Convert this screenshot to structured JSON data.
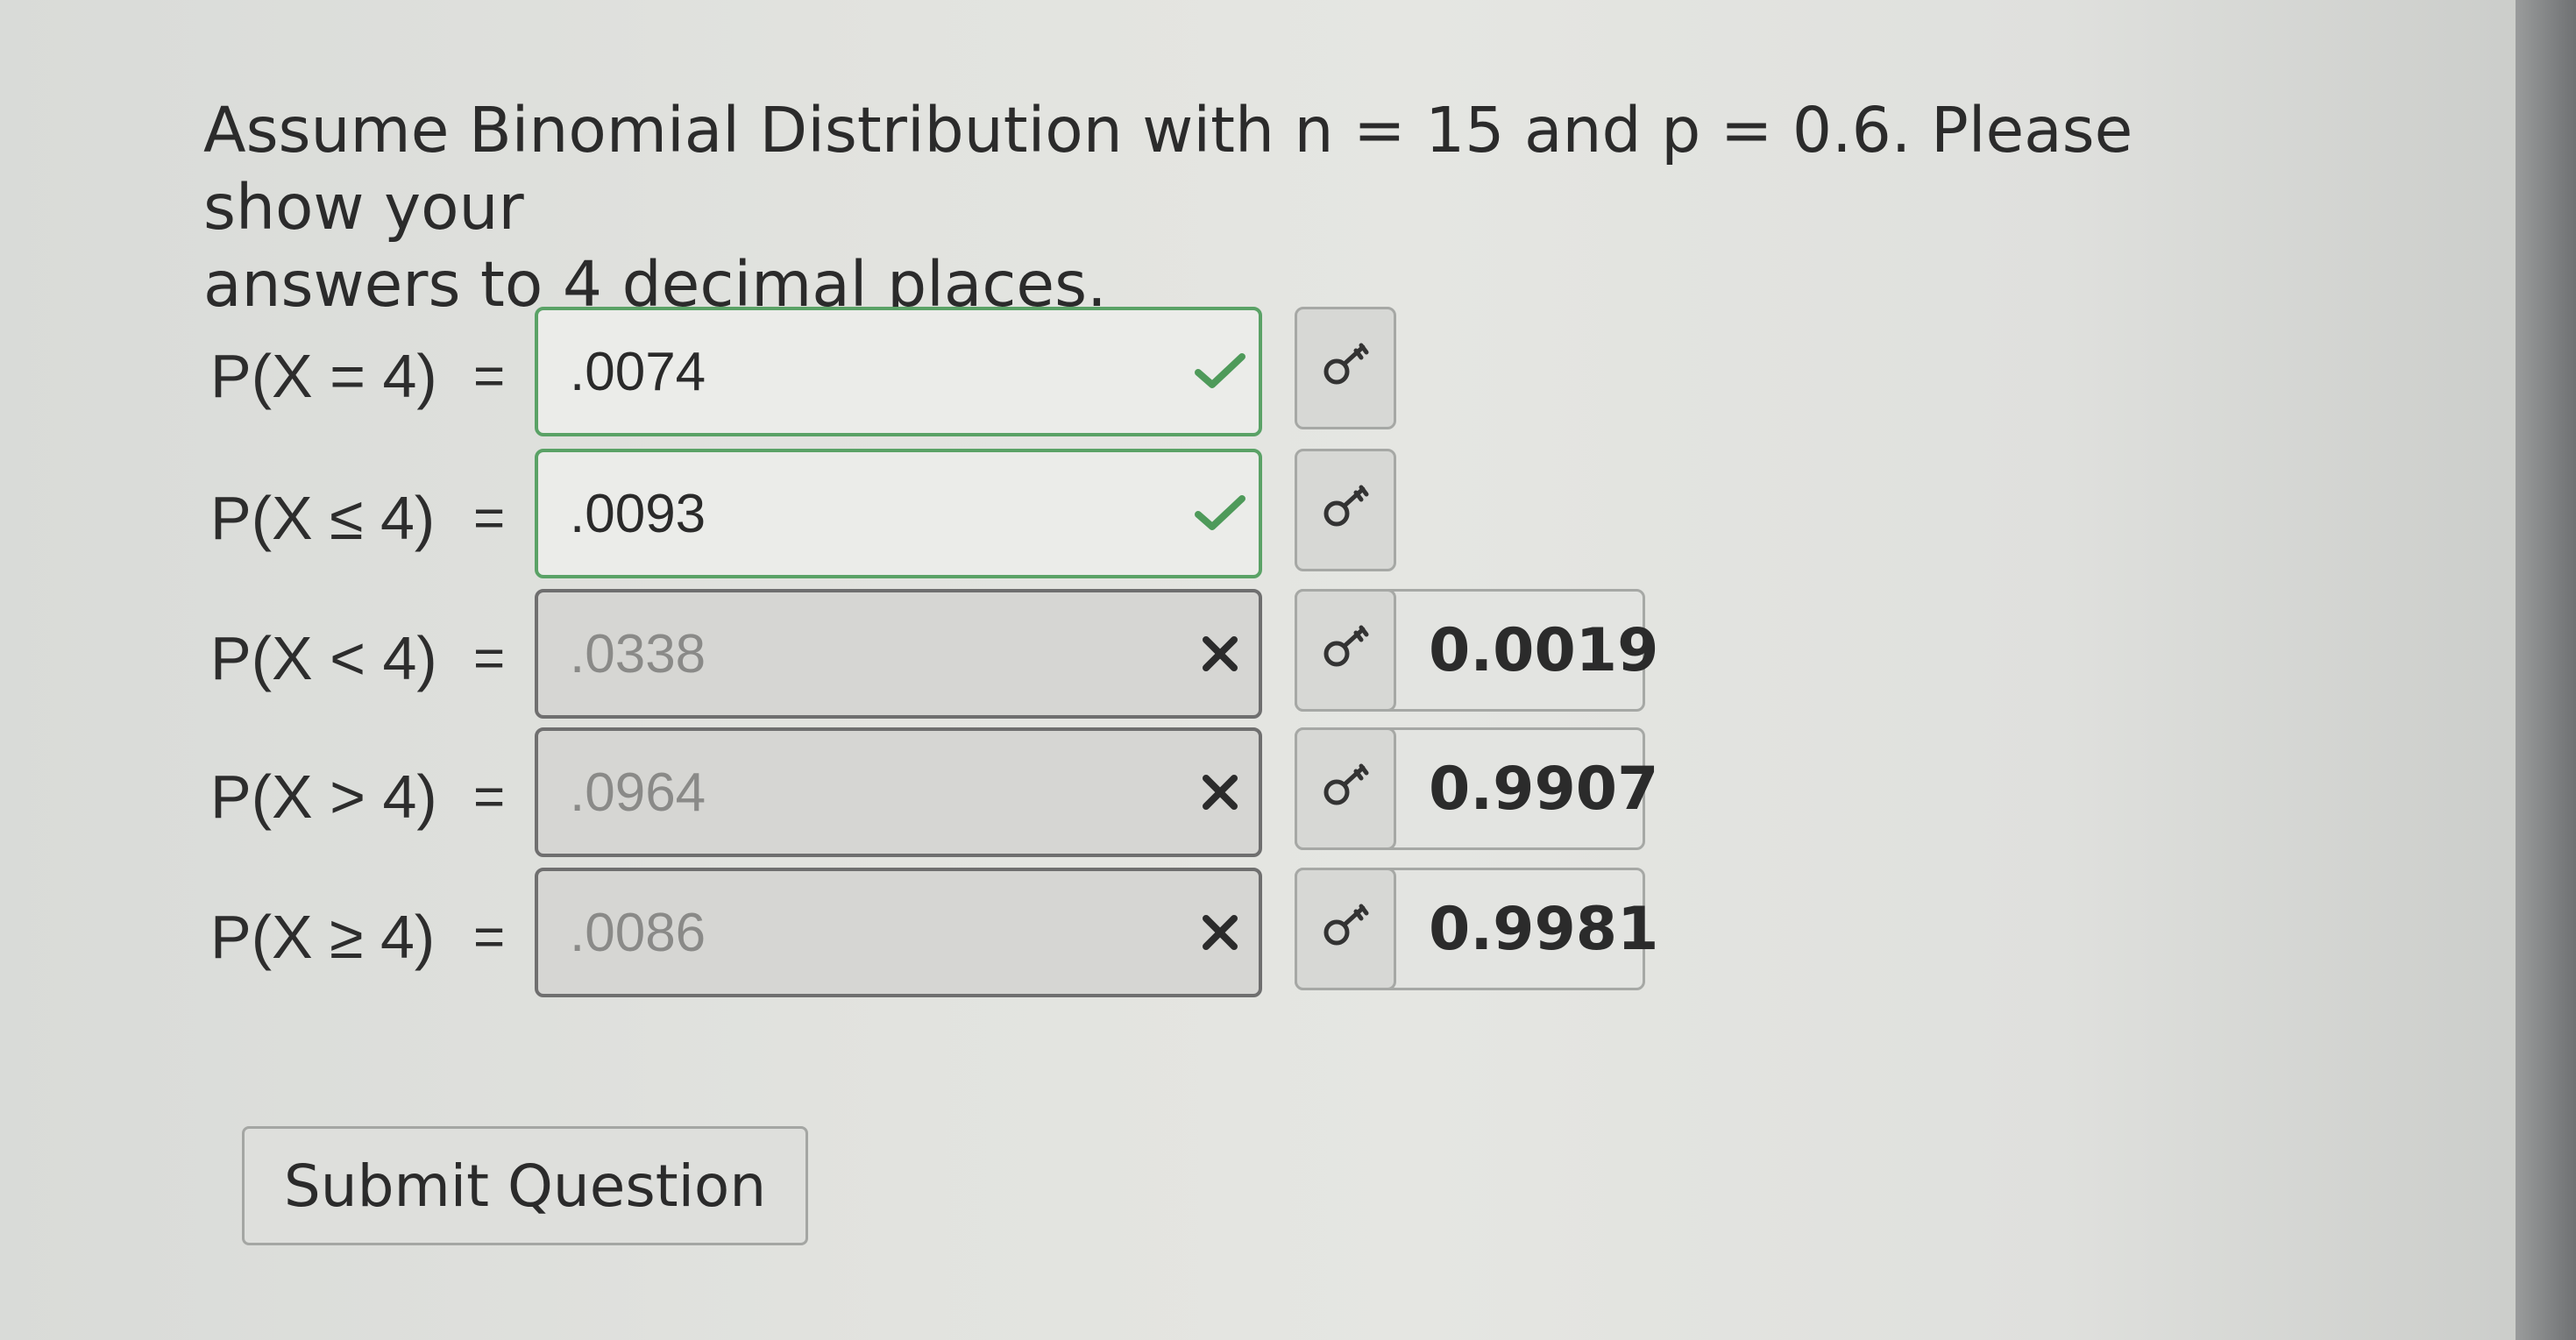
{
  "question": {
    "line1": "Assume Binomial Distribution with n = 15 and p = 0.6. Please show your",
    "line2": "answers to 4 decimal places."
  },
  "rows": [
    {
      "label": "P(X = 4)",
      "equals": "=",
      "value": ".0074",
      "status": "correct",
      "key_icon": "key-icon",
      "shown_answer": ""
    },
    {
      "label": "P(X ≤ 4)",
      "equals": "=",
      "value": ".0093",
      "status": "correct",
      "key_icon": "key-icon",
      "shown_answer": ""
    },
    {
      "label": "P(X < 4)",
      "equals": "=",
      "value": ".0338",
      "status": "incorrect",
      "key_icon": "key-icon",
      "shown_answer": "0.0019"
    },
    {
      "label": "P(X > 4)",
      "equals": "=",
      "value": ".0964",
      "status": "incorrect",
      "key_icon": "key-icon",
      "shown_answer": "0.9907"
    },
    {
      "label": "P(X ≥ 4)",
      "equals": "=",
      "value": ".0086",
      "status": "incorrect",
      "key_icon": "key-icon",
      "shown_answer": "0.9981"
    }
  ],
  "submit": {
    "label": "Submit Question"
  },
  "colors": {
    "correct": "#4e9a5a",
    "incorrect": "#2b2b2b",
    "correct_border": "#5aa266"
  }
}
